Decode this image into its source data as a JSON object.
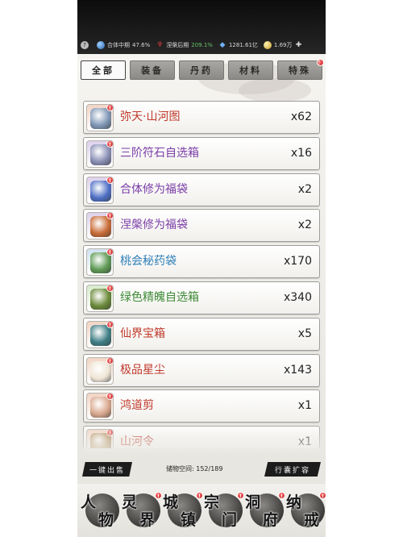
{
  "status_bar": {
    "realm_label": "合体中期",
    "realm_progress": "47.6%",
    "realm2_label": "涅槃后期",
    "realm2_progress": "209.1%",
    "spirit_stones": "1281.61亿",
    "gold": "1.69万",
    "icons": [
      "help-icon",
      "realm-orb-icon",
      "flame-icon",
      "spirit-gem-icon",
      "gold-coin-icon",
      "plus-icon"
    ]
  },
  "tabs": [
    {
      "label": "全部",
      "active": true,
      "badge": false
    },
    {
      "label": "装备",
      "active": false,
      "badge": false
    },
    {
      "label": "丹药",
      "active": false,
      "badge": false
    },
    {
      "label": "材料",
      "active": false,
      "badge": false
    },
    {
      "label": "特殊",
      "active": false,
      "badge": true
    }
  ],
  "items": [
    {
      "name": "弥天·山河图",
      "qty": "x62",
      "name_color": "#c0392b",
      "bg": "#f2d4c4",
      "art": "#7f97b5",
      "icon": "scroll-map-icon"
    },
    {
      "name": "三阶符石自选箱",
      "qty": "x16",
      "name_color": "#7b3ea8",
      "bg": "#ddd0ec",
      "art": "#8a8fb5",
      "icon": "rune-chest-icon"
    },
    {
      "name": "合体修为福袋",
      "qty": "x2",
      "name_color": "#7b3ea8",
      "bg": "#ddd0ec",
      "art": "#4e6fc4",
      "icon": "blessing-pouch-icon"
    },
    {
      "name": "涅槃修为福袋",
      "qty": "x2",
      "name_color": "#7b3ea8",
      "bg": "#ddd0ec",
      "art": "#c96b36",
      "icon": "blessing-pouch-icon"
    },
    {
      "name": "桃会秘药袋",
      "qty": "x170",
      "name_color": "#2f7fb8",
      "bg": "#cfe2f1",
      "art": "#5f9a55",
      "icon": "peach-medicine-bag-icon"
    },
    {
      "name": "绿色精魄自选箱",
      "qty": "x340",
      "name_color": "#3e8a36",
      "bg": "#d6ebcc",
      "art": "#6b8a3a",
      "icon": "green-soul-chest-icon"
    },
    {
      "name": "仙界宝箱",
      "qty": "x5",
      "name_color": "#c0392b",
      "bg": "#f2d4c4",
      "art": "#3f7f86",
      "icon": "immortal-chest-icon"
    },
    {
      "name": "极品星尘",
      "qty": "x143",
      "name_color": "#c0392b",
      "bg": "#f2d4c4",
      "art": "#efe6d6",
      "icon": "stardust-icon"
    },
    {
      "name": "鸿道剪",
      "qty": "x1",
      "name_color": "#c0392b",
      "bg": "#f2d4c4",
      "art": "#d9a88e",
      "icon": "scissors-icon"
    },
    {
      "name": "山河令",
      "qty": "x1",
      "name_color": "#c0392b",
      "bg": "#f2d4c4",
      "art": "#b08a52",
      "icon": "token-icon"
    }
  ],
  "bottom_bar": {
    "sell_label": "一键出售",
    "storage_label": "储物空间: 152/189",
    "expand_label": "行囊扩容"
  },
  "nav": [
    {
      "chars": [
        "人",
        "物"
      ],
      "badge": false
    },
    {
      "chars": [
        "灵",
        "界"
      ],
      "badge": true
    },
    {
      "chars": [
        "城",
        "镇"
      ],
      "badge": true
    },
    {
      "chars": [
        "宗",
        "门"
      ],
      "badge": true
    },
    {
      "chars": [
        "洞",
        "府"
      ],
      "badge": true
    },
    {
      "chars": [
        "纳",
        "戒"
      ],
      "badge": true
    }
  ],
  "badge_mark": "!"
}
